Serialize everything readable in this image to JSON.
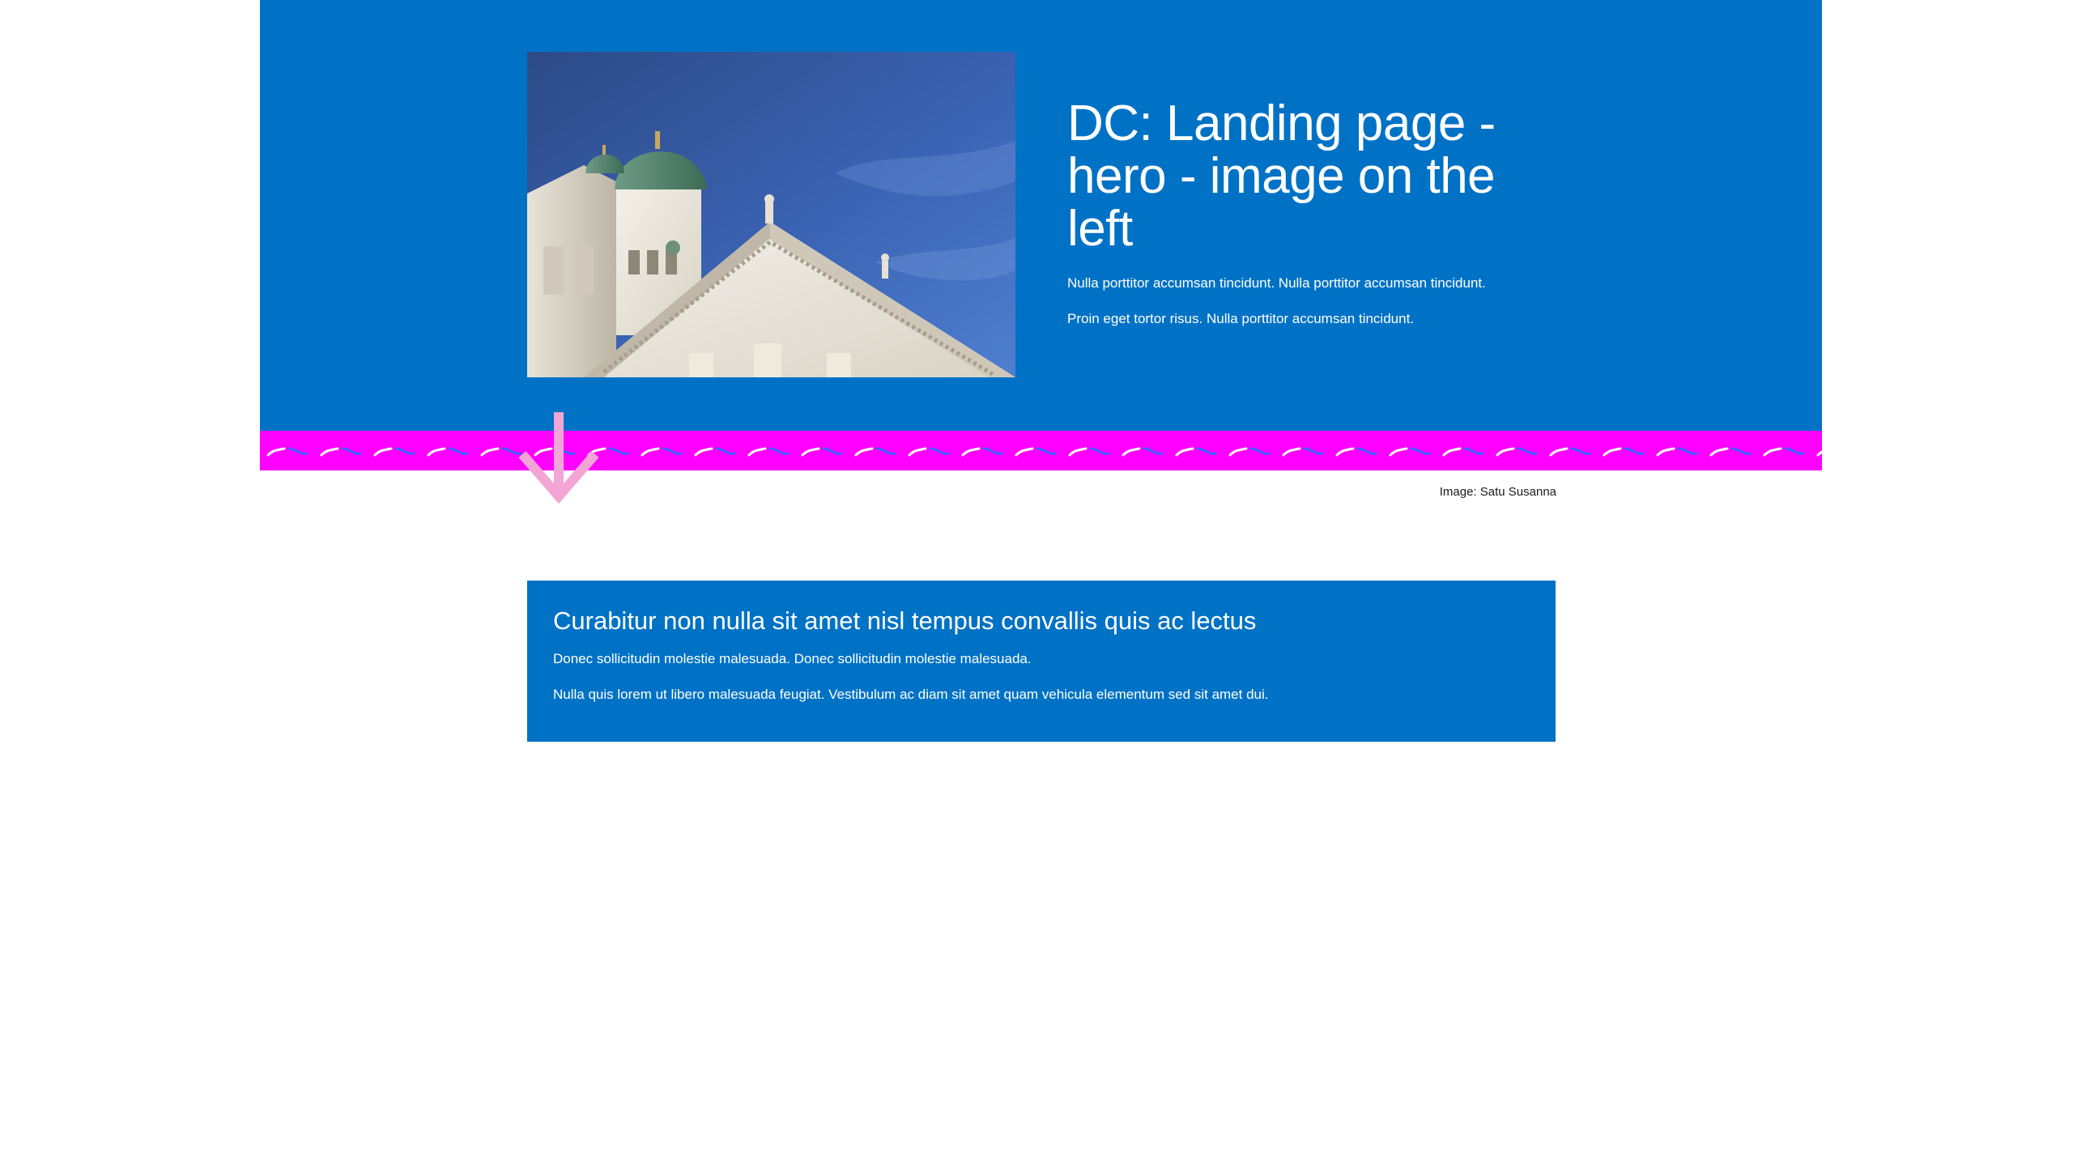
{
  "hero": {
    "title": "DC: Landing page - hero - image on the left",
    "paragraphs": [
      "Nulla porttitor accumsan tincidunt. Nulla porttitor accumsan tincidunt.",
      "Proin eget tortor risus. Nulla porttitor accumsan tincidunt."
    ],
    "image_alt": "Helsinki Cathedral against a blue sky",
    "image_caption": "Image: Satu Susanna"
  },
  "koros": {
    "icon": "koros-wave-stripe"
  },
  "scroll_arrow": {
    "icon": "arrow-down-icon"
  },
  "card": {
    "title": "Curabitur non nulla sit amet nisl tempus convallis quis ac lectus",
    "paragraphs": [
      "Donec sollicitudin molestie malesuada. Donec sollicitudin molestie malesuada.",
      "Nulla quis lorem ut libero malesuada feugiat. Vestibulum ac diam sit amet quam vehicula elementum sed sit amet dui."
    ]
  },
  "colors": {
    "hero_background": "#0072c6",
    "koros_background": "#ff00ff",
    "koros_stroke_blue": "#3f5fff",
    "koros_stroke_white": "#ffffff",
    "arrow": "#f3a6d6",
    "card_background": "#0072c6",
    "text_on_blue": "#ffffff",
    "caption_text": "#1a1a1a"
  }
}
